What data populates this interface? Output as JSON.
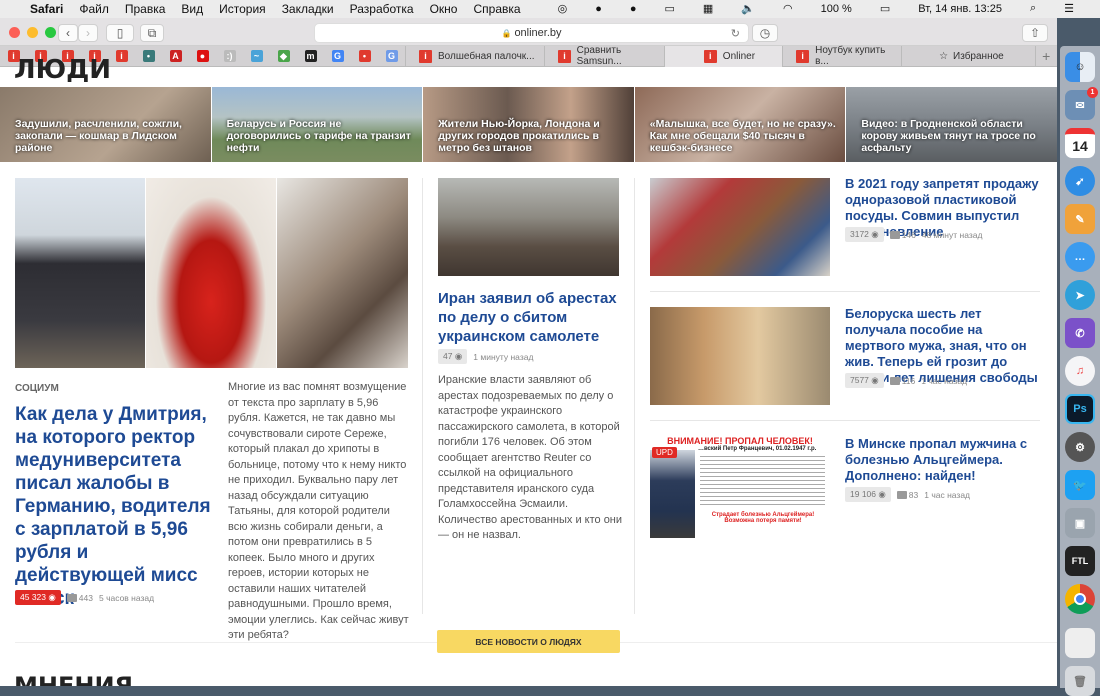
{
  "menubar": {
    "app": "Safari",
    "items": [
      "Файл",
      "Правка",
      "Вид",
      "История",
      "Закладки",
      "Разработка",
      "Окно",
      "Справка"
    ],
    "battery": "100 %",
    "datetime": "Вт, 14 янв.  13:25"
  },
  "toolbar": {
    "url": "onliner.by"
  },
  "bookmarks": [
    {
      "g": "i",
      "c": "#e03a2e"
    },
    {
      "g": "i",
      "c": "#e03a2e"
    },
    {
      "g": "i",
      "c": "#e03a2e"
    },
    {
      "g": "i",
      "c": "#e03a2e"
    },
    {
      "g": "i",
      "c": "#e03a2e"
    },
    {
      "g": "•",
      "c": "#3a7a7a"
    },
    {
      "g": "A",
      "c": "#c22"
    },
    {
      "g": "●",
      "c": "#d11"
    },
    {
      "g": ":)",
      "c": "#bbb"
    },
    {
      "g": "~",
      "c": "#4aa3d8"
    },
    {
      "g": "◆",
      "c": "#4aa54a"
    },
    {
      "g": "m",
      "c": "#222"
    },
    {
      "g": "G",
      "c": "#4285f4"
    },
    {
      "g": "•",
      "c": "#e03a2e"
    },
    {
      "g": "G",
      "c": "#6f9be8"
    }
  ],
  "tabs": [
    {
      "label": "Волшебная палочк..."
    },
    {
      "label": "Сравнить Samsun..."
    },
    {
      "label": "Onliner"
    },
    {
      "label": "Ноутбук купить в..."
    }
  ],
  "favorites_label": "Избранное",
  "section": {
    "title": "ЛЮДИ",
    "next_title": "МНЕНИЯ"
  },
  "strip": [
    {
      "text": "Задушили, расчленили, сожгли, закопали — кошмар в Лидском районе"
    },
    {
      "text": "Беларусь и Россия не договорились о тарифе на транзит нефти"
    },
    {
      "text": "Жители Нью-Йорка, Лондона и других городов прокатились в метро без штанов"
    },
    {
      "text": "«Малышка, все будет, но не сразу». Как мне обещали $40 тысяч в кешбэк-бизнесе"
    },
    {
      "text": "Видео: в Гродненской области корову живьем тянут на тросе по асфальту"
    }
  ],
  "main": {
    "rubric": "СОЦИУМ",
    "title": "Как дела у Дмитрия, на которого ректор медуниверситета писал жалобы в Германию, водителя с зарплатой в 5,96 рубля и действующей мисс Минск",
    "views": "45 323",
    "comments": "443",
    "time": "5 часов назад",
    "text": "Многие из вас помнят возмущение от текста про зарплату в 5,96 рубля. Кажется, не так давно мы сочувствовали сироте Сереже, который плакал до хрипоты в больнице, потому что к нему никто не приходил. Буквально пару лет назад обсуждали ситуацию Татьяны, для которой родители всю жизнь собирали деньги, а потом они превратились в 5 копеек. Было много и других героев, истории которых не оставили наших читателей равнодушными. Прошло время, эмоции улеглись. Как сейчас живут эти ребята?"
  },
  "middle": {
    "title": "Иран заявил об арестах по делу о сбитом украинском самолете",
    "views": "47",
    "time": "1 минуту назад",
    "text": "Иранские власти заявляют об арестах подозреваемых по делу о катастрофе украинского пассажирского самолета, в которой погибли 176 человек. Об этом сообщает агентство Reuter со ссылкой на официального представителя иранского суда Голамхоссейна Эсмаили. Количество арестованных и кто они — он не назвал."
  },
  "side": [
    {
      "title": "В 2021 году запретят продажу одноразовой пластиковой посуды. Совмин выпустил постановление",
      "views": "3172",
      "comments": "146",
      "time": "48 минут назад"
    },
    {
      "title": "Белоруска шесть лет получала пособие на мертвого мужа, зная, что он жив. Теперь ей грозит до десяти лет лишения свободы",
      "views": "7577",
      "comments": "116",
      "time": "1 час назад"
    },
    {
      "title": "В Минске пропал мужчина с болезнью Альцгеймера. Дополнено: найден!",
      "views": "19 106",
      "comments": "83",
      "time": "1 час назад",
      "badge": "UPD",
      "poster_title": "ВНИМАНИЕ! ПРОПАЛ ЧЕЛОВЕК!",
      "poster_name": "…вский Петр Францевич, 01.02.1947 г.р.",
      "poster_footer": "Страдает болезнью Альцгеймера! Возможна потеря памяти!"
    }
  ],
  "more_button": "ВСЕ НОВОСТИ О ЛЮДЯХ",
  "dock": {
    "calendar_day": "14",
    "mail_badge": "1",
    "ps": "Ps",
    "ftl": "FTL"
  }
}
